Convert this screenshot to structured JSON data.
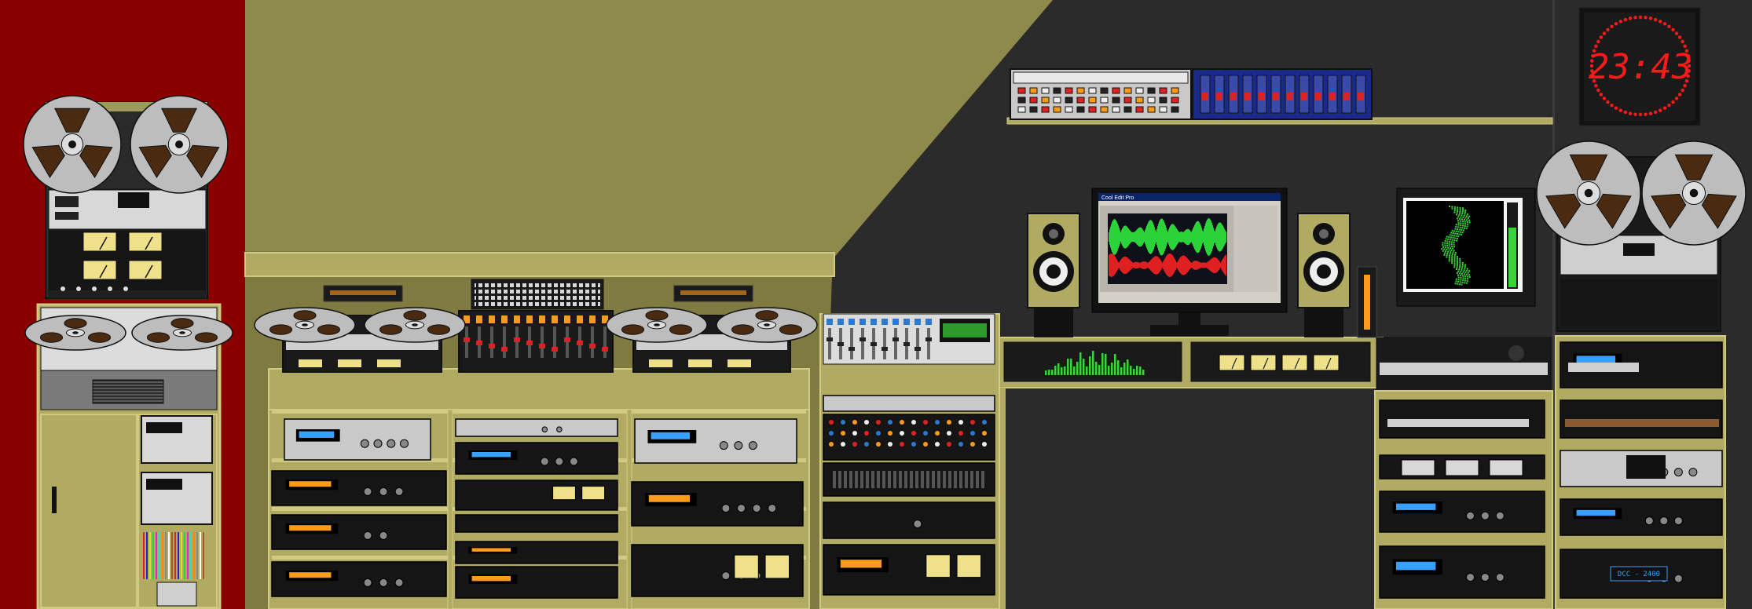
{
  "clock": {
    "time": "23:43",
    "digit_color": "#ff1a1a",
    "face_color": "#160000"
  },
  "screen": {
    "window_title": "Cool Edit Pro"
  },
  "dcc_label": "DCC - 2400",
  "colors": {
    "left_wall": "#8a0000",
    "olive_wall": "#8e8a4c",
    "dark_wall": "#2b2b2b",
    "shelf": "#b1aa63",
    "shelf_edge": "#d0ca82",
    "device_black": "#151515",
    "device_silver": "#c9c9c9",
    "reel": "#bdbdbd",
    "vu_face": "#efe18a",
    "lcd_blue": "#3aa0ff",
    "lcd_orange": "#ff9a1a",
    "lcd_green": "#39d43a"
  }
}
